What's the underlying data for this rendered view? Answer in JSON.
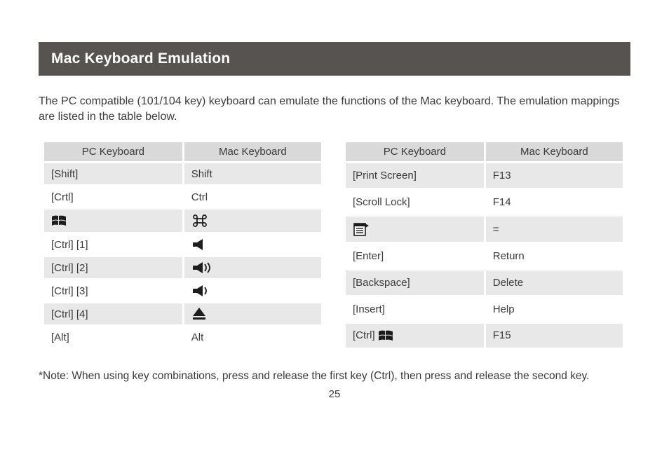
{
  "header": {
    "title": "Mac Keyboard Emulation"
  },
  "intro": "The PC compatible (101/104 key) keyboard can emulate the functions of the Mac keyboard. The emulation mappings are listed in the table below.",
  "tables": {
    "headers": {
      "pc": "PC Keyboard",
      "mac": "Mac Keyboard"
    },
    "left": [
      {
        "pc_text": "[Shift]",
        "mac_text": "Shift",
        "pc_icon": null,
        "mac_icon": null,
        "shade": true
      },
      {
        "pc_text": "[Crtl]",
        "mac_text": "Ctrl",
        "pc_icon": null,
        "mac_icon": null,
        "shade": false
      },
      {
        "pc_text": "",
        "mac_text": "",
        "pc_icon": "windows",
        "mac_icon": "command",
        "shade": true
      },
      {
        "pc_text": "[Ctrl] [1]",
        "mac_text": "",
        "pc_icon": null,
        "mac_icon": "mute",
        "shade": false
      },
      {
        "pc_text": "[Ctrl] [2]",
        "mac_text": "",
        "pc_icon": null,
        "mac_icon": "volup",
        "shade": true
      },
      {
        "pc_text": "[Ctrl] [3]",
        "mac_text": "",
        "pc_icon": null,
        "mac_icon": "voldown",
        "shade": false
      },
      {
        "pc_text": "[Ctrl] [4]",
        "mac_text": "",
        "pc_icon": null,
        "mac_icon": "eject",
        "shade": true
      },
      {
        "pc_text": "[Alt]",
        "mac_text": "Alt",
        "pc_icon": null,
        "mac_icon": null,
        "shade": false
      }
    ],
    "right": [
      {
        "pc_text": "[Print Screen]",
        "mac_text": "F13",
        "pc_icon": null,
        "mac_icon": null,
        "shade": true
      },
      {
        "pc_text": "[Scroll Lock]",
        "mac_text": "F14",
        "pc_icon": null,
        "mac_icon": null,
        "shade": false
      },
      {
        "pc_text": "",
        "mac_text": "=",
        "pc_icon": "appmenu",
        "mac_icon": null,
        "shade": true
      },
      {
        "pc_text": "[Enter]",
        "mac_text": "Return",
        "pc_icon": null,
        "mac_icon": null,
        "shade": false
      },
      {
        "pc_text": "[Backspace]",
        "mac_text": "Delete",
        "pc_icon": null,
        "mac_icon": null,
        "shade": true
      },
      {
        "pc_text": "[Insert]",
        "mac_text": "Help",
        "pc_icon": null,
        "mac_icon": null,
        "shade": false
      },
      {
        "pc_text": "[Ctrl] ",
        "mac_text": "F15",
        "pc_icon": "windows",
        "mac_icon": null,
        "shade": true,
        "pc_icon_after_text": true
      }
    ]
  },
  "note": "*Note: When using key combinations, press and release the first key (Ctrl), then press and release the second key.",
  "page_number": "25"
}
